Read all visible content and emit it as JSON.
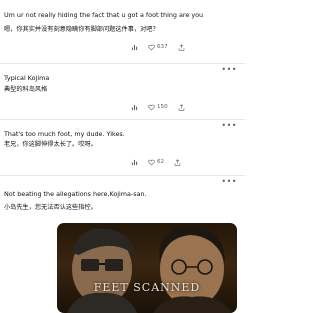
{
  "replies": [
    {
      "text_en": "Um ur not really hiding the fact that u got a foot thing are you",
      "text_zh": "嗯，你其实并没有刻意隐瞒你有脚部问题这件事，对吧？",
      "like_count": "637"
    },
    {
      "text_en": "Typical Kojima",
      "text_zh": "典型的科岛风格",
      "like_count": "150"
    },
    {
      "text_en": "That's too much foot, my dude. Yikes.",
      "text_zh": "老兄，你这脚伸得太长了。哎呀。",
      "like_count": "62"
    },
    {
      "text_en": "Not beating the allegations here,Kojima-san.",
      "text_zh": "小岛先生，您无法否认这些指控。"
    }
  ],
  "media": {
    "caption": "FEET SCANNED"
  },
  "icons": {
    "more": "more-horizontal-icon",
    "views": "bar-chart-icon",
    "like": "heart-icon",
    "share": "share-icon"
  },
  "colors": {
    "icon_gray": "#536471",
    "text": "#0f1419",
    "divider": "#e6e9ec"
  }
}
